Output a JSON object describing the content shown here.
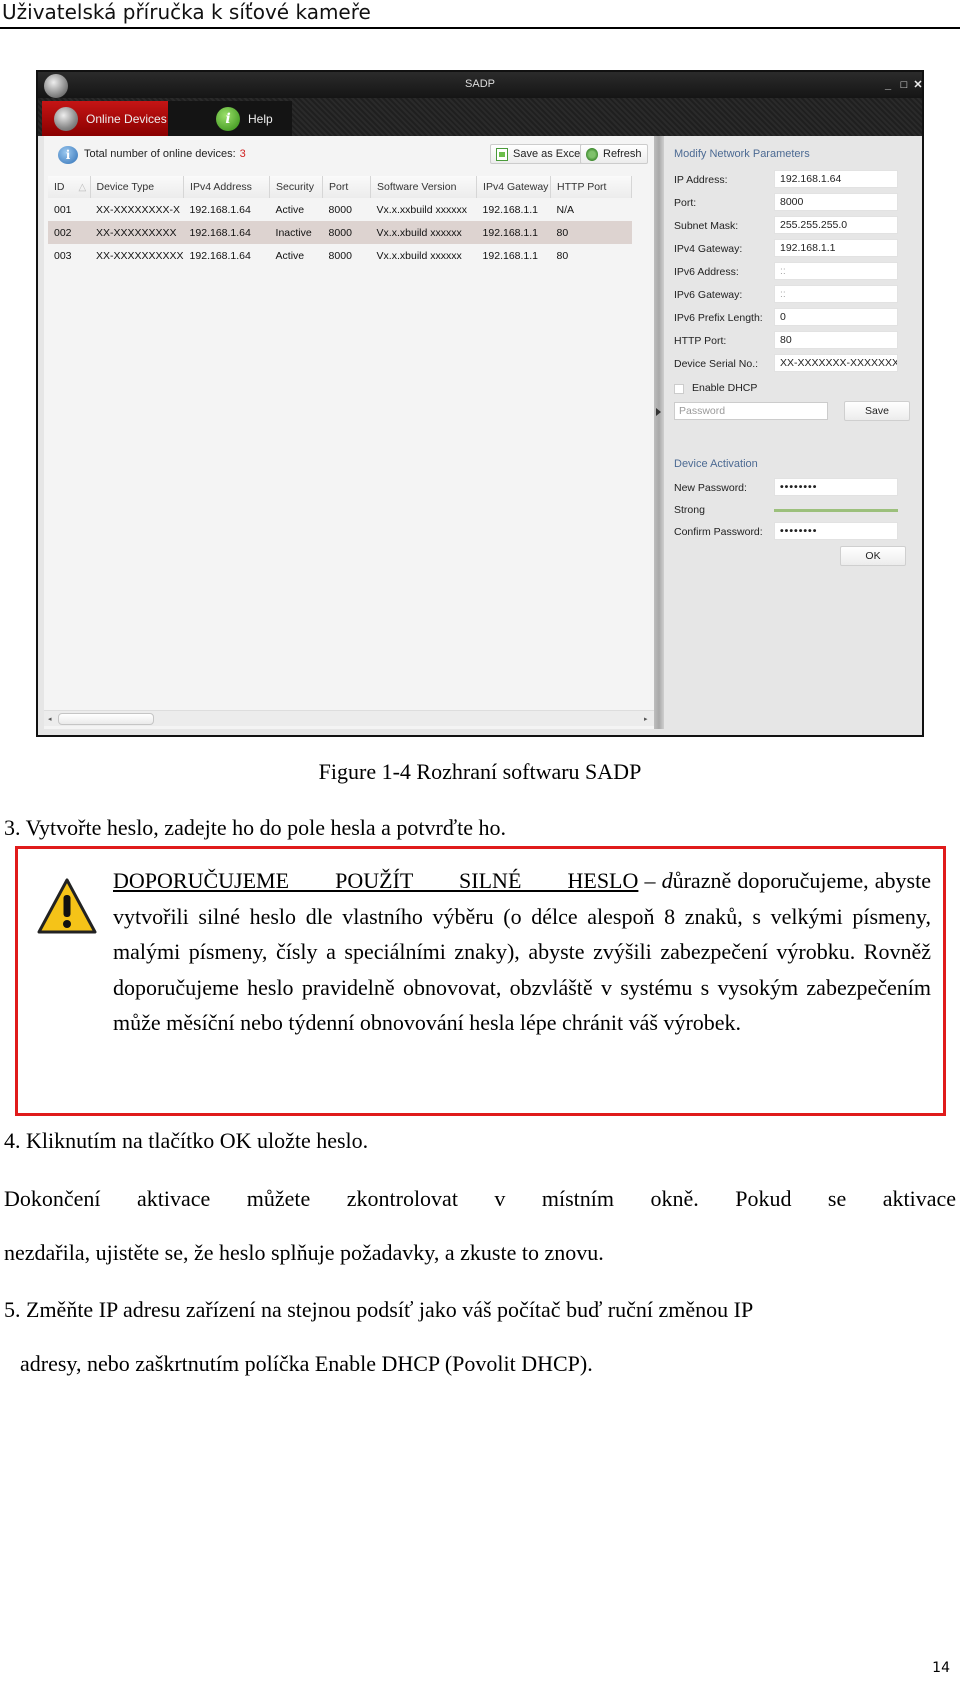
{
  "page": {
    "header": "Uživatelská příručka k síťové kameře",
    "page_number": "14"
  },
  "sadp": {
    "window_title": "SADP",
    "window_controls": [
      "minimize",
      "maximize",
      "close"
    ],
    "tabs": [
      {
        "label": "Online Devices",
        "icon": "online-devices-icon",
        "active": true
      },
      {
        "label": "Help",
        "icon": "help-icon",
        "active": false
      }
    ],
    "toolbar": {
      "total_label": "Total number of online devices:",
      "total_count": "3",
      "save_excel": "Save as Excel",
      "refresh": "Refresh"
    },
    "table": {
      "columns": [
        "ID",
        "Device Type",
        "IPv4 Address",
        "Security",
        "Port",
        "Software Version",
        "IPv4 Gateway",
        "HTTP Port"
      ],
      "rows": [
        [
          "001",
          "XX-XXXXXXXX-X",
          "192.168.1.64",
          "Active",
          "8000",
          "Vx.x.xxbuild xxxxxx",
          "192.168.1.1",
          "N/A"
        ],
        [
          "002",
          "XX-XXXXXXXXX",
          "192.168.1.64",
          "Inactive",
          "8000",
          "Vx.x.xbuild xxxxxx",
          "192.168.1.1",
          "80"
        ],
        [
          "003",
          "XX-XXXXXXXXXX",
          "192.168.1.64",
          "Active",
          "8000",
          "Vx.x.xbuild xxxxxx",
          "192.168.1.1",
          "80"
        ]
      ],
      "selected_row": 1
    },
    "network": {
      "title": "Modify Network Parameters",
      "fields": [
        {
          "label": "IP Address:",
          "value": "192.168.1.64"
        },
        {
          "label": "Port:",
          "value": "8000"
        },
        {
          "label": "Subnet Mask:",
          "value": "255.255.255.0"
        },
        {
          "label": "IPv4 Gateway:",
          "value": "192.168.1.1"
        },
        {
          "label": "IPv6 Address:",
          "value": "::"
        },
        {
          "label": "IPv6 Gateway:",
          "value": "::"
        },
        {
          "label": "IPv6 Prefix Length:",
          "value": "0"
        },
        {
          "label": "HTTP Port:",
          "value": "80"
        },
        {
          "label": "Device Serial No.:",
          "value": "XX-XXXXXXX-XXXXXXXX"
        }
      ],
      "dhcp_label": "Enable DHCP",
      "dhcp_checked": false,
      "password_placeholder": "Password",
      "save": "Save"
    },
    "activation": {
      "title": "Device Activation",
      "new_password_label": "New Password:",
      "new_password_value": "••••••••",
      "strength_label": "Strong",
      "strength_color": "#9cc07c",
      "confirm_label": "Confirm Password:",
      "confirm_value": "••••••••",
      "ok": "OK"
    }
  },
  "doc": {
    "caption": "Figure 1-4 Rozhraní softwaru SADP",
    "step3": "3. Vytvořte heslo, zadejte ho do pole hesla a potvrďte ho.",
    "warning": {
      "heading": "DOPORUČUJEME POUŽÍT SILNÉ HESLO",
      "dash": " – ",
      "italic_lead": "d",
      "body_first": "ůrazně doporučujeme, abyste vytvořili silné heslo dle vlastního výběru (o délce alespoň 8 znaků, s velkými písmeny, malými písmeny, čísly a speciálními znaky), abyste zvýšili zabezpečení výrobku. Rovněž doporučujeme heslo pravidelně obnovovat, obzvláště v systému s vysokým zabezpečením může měsíční nebo týdenní obnovování hesla lépe chránit váš výrobek."
    },
    "step4": "4. Kliknutím na tlačítko OK uložte heslo.",
    "para1_line1": "Dokončení aktivace můžete zkontrolovat v místním okně. Pokud se aktivace",
    "para1_line2": "nezdařila, ujistěte se, že heslo splňuje požadavky, a zkuste to znovu.",
    "step5_line1": "5. Změňte IP adresu zařízení na stejnou podsíť jako váš počítač buď ruční změnou IP",
    "step5_line2": "adresy, nebo zaškrtnutím políčka Enable DHCP (Povolit DHCP)."
  }
}
